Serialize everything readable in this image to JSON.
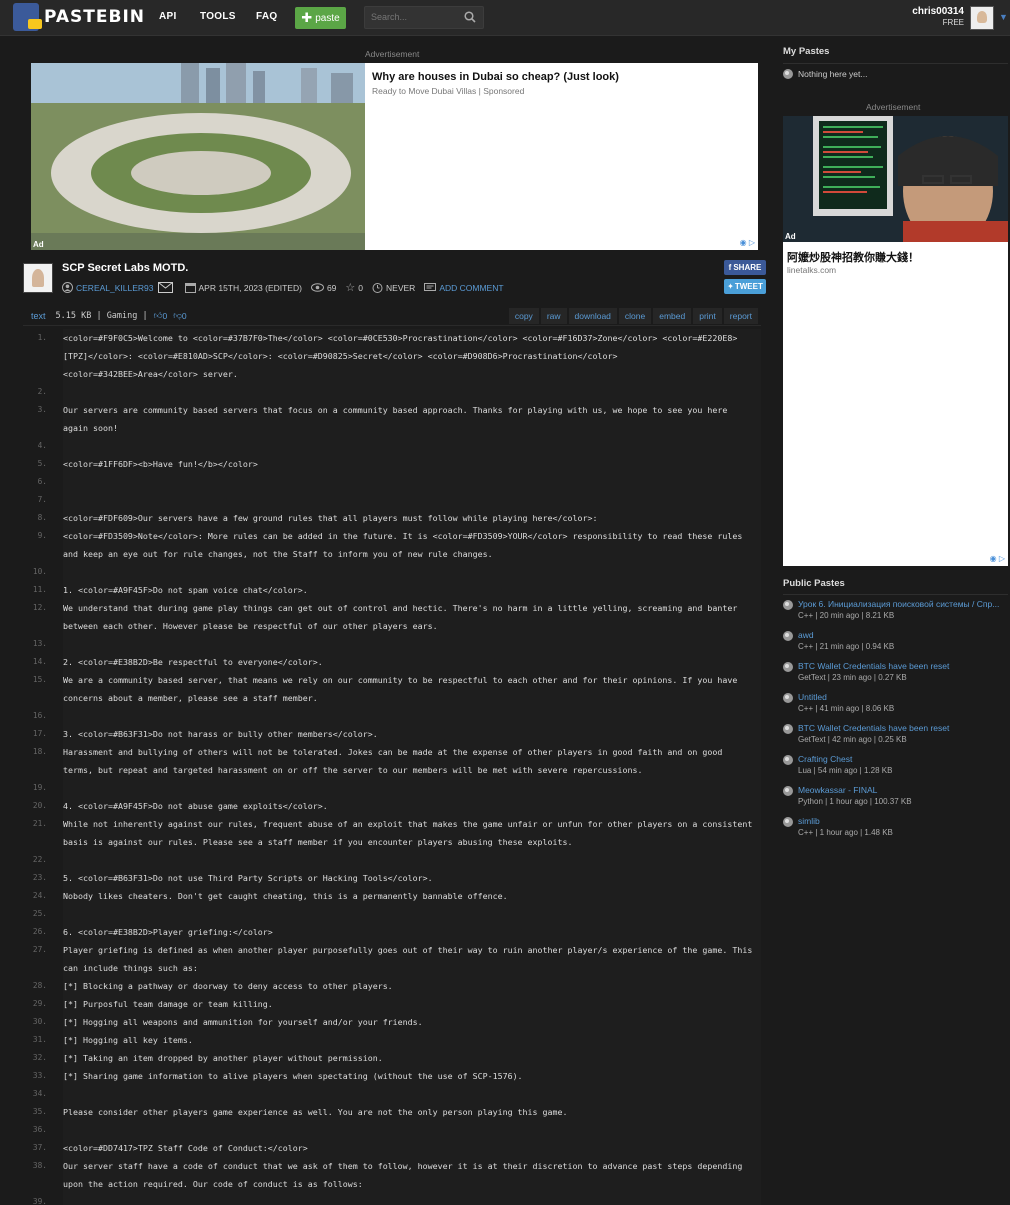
{
  "header": {
    "logo_text": "PASTEBIN",
    "nav": [
      "API",
      "TOOLS",
      "FAQ"
    ],
    "paste_button": "paste",
    "search_placeholder": "Search...",
    "username": "chris00314",
    "plan": "FREE"
  },
  "ad_top": {
    "label": "Advertisement",
    "title": "Why are houses in Dubai so cheap? (Just look)",
    "sponsor": "Ready to Move Dubai Villas | Sponsored",
    "ad_tag": "Ad"
  },
  "paste": {
    "title": "SCP Secret Labs MOTD.",
    "author": "CEREAL_KILLER93",
    "date": "APR 15TH, 2023 (EDITED)",
    "views": "69",
    "stars": "0",
    "expires": "NEVER",
    "add_comment": "ADD COMMENT",
    "share": "SHARE",
    "tweet": "TWEET"
  },
  "toolbar": {
    "format": "text",
    "info": "5.15 KB | Gaming |",
    "likes": "0",
    "dislikes": "0",
    "actions": [
      "copy",
      "raw",
      "download",
      "clone",
      "embed",
      "print",
      "report"
    ]
  },
  "code_lines": [
    {
      "n": "1.",
      "t": "<color=#F9F0C5>Welcome to <color=#37B7F0>The</color> <color=#0CE530>Procrastination</color> <color=#F16D37>Zone</color> <color=#E220E8>[TPZ]</color>: <color=#E810AD>SCP</color>: <color=#D90825>Secret</color> <color=#D908D6>Procrastination</color> <color=#342BEE>Area</color> server."
    },
    {
      "n": "2.",
      "t": ""
    },
    {
      "n": "3.",
      "t": "Our servers are community based servers that focus on a community based approach. Thanks for playing with us, we hope to see you here again soon!"
    },
    {
      "n": "4.",
      "t": ""
    },
    {
      "n": "5.",
      "t": "<color=#1FF6DF><b>Have fun!</b></color>"
    },
    {
      "n": "6.",
      "t": ""
    },
    {
      "n": "7.",
      "t": ""
    },
    {
      "n": "8.",
      "t": "<color=#FDF609>Our servers have a few ground rules that all players must follow while playing here</color>:"
    },
    {
      "n": "9.",
      "t": "<color=#FD3509>Note</color>: More rules can be added in the future. It is <color=#FD3509>YOUR</color> responsibility to read these rules and keep an eye out for rule changes, not the Staff to inform you of new rule changes."
    },
    {
      "n": "10.",
      "t": ""
    },
    {
      "n": "11.",
      "t": "1. <color=#A9F45F>Do not spam voice chat</color>."
    },
    {
      "n": "12.",
      "t": "We understand that during game play things can get out of control and hectic. There's no harm in a little yelling, screaming and banter between each other. However please be respectful of our other players ears."
    },
    {
      "n": "13.",
      "t": ""
    },
    {
      "n": "14.",
      "t": "2. <color=#E38B2D>Be respectful to everyone</color>."
    },
    {
      "n": "15.",
      "t": "We are a community based server, that means we rely on our community to be respectful to each other and for their opinions. If you have concerns about a member, please see a staff member."
    },
    {
      "n": "16.",
      "t": ""
    },
    {
      "n": "17.",
      "t": "3. <color=#B63F31>Do not harass or bully other members</color>."
    },
    {
      "n": "18.",
      "t": "Harassment and bullying of others will not be tolerated. Jokes can be made at the expense of other players in good faith and on good terms, but repeat and targeted harassment on or off the server to our members will be met with severe repercussions."
    },
    {
      "n": "19.",
      "t": ""
    },
    {
      "n": "20.",
      "t": "4. <color=#A9F45F>Do not abuse game exploits</color>."
    },
    {
      "n": "21.",
      "t": "While not inherently against our rules, frequent abuse of an exploit that makes the game unfair or unfun for other players on a consistent basis is against our rules. Please see a staff member if you encounter players abusing these exploits."
    },
    {
      "n": "22.",
      "t": ""
    },
    {
      "n": "23.",
      "t": "5. <color=#B63F31>Do not use Third Party Scripts or Hacking Tools</color>."
    },
    {
      "n": "24.",
      "t": "Nobody likes cheaters. Don't get caught cheating, this is a permanently bannable offence."
    },
    {
      "n": "25.",
      "t": ""
    },
    {
      "n": "26.",
      "t": "6. <color=#E38B2D>Player griefing:</color>"
    },
    {
      "n": "27.",
      "t": "Player griefing is defined as when another player purposefully goes out of their way to ruin another player/s experience of the game. This can include things such as:"
    },
    {
      "n": "28.",
      "t": "[*] Blocking a pathway or doorway to deny access to other players."
    },
    {
      "n": "29.",
      "t": "[*] Purposful team damage or team killing."
    },
    {
      "n": "30.",
      "t": "[*] Hogging all weapons and ammunition for yourself and/or your friends."
    },
    {
      "n": "31.",
      "t": "[*] Hogging all key items."
    },
    {
      "n": "32.",
      "t": "[*] Taking an item dropped by another player without permission."
    },
    {
      "n": "33.",
      "t": "[*] Sharing game information to alive players when spectating (without the use of SCP-1576)."
    },
    {
      "n": "34.",
      "t": ""
    },
    {
      "n": "35.",
      "t": "Please consider other players game experience as well. You are not the only person playing this game."
    },
    {
      "n": "36.",
      "t": ""
    },
    {
      "n": "37.",
      "t": "<color=#DD7417>TPZ Staff Code of Conduct:</color>"
    },
    {
      "n": "38.",
      "t": "Our server staff have a code of conduct that we ask of them to follow, however it is at their discretion to advance past steps depending upon the action required. Our code of conduct is as follows:"
    },
    {
      "n": "39.",
      "t": ""
    }
  ],
  "sidebar": {
    "my_pastes_heading": "My Pastes",
    "nothing_here": "Nothing here yet...",
    "ad_label": "Advertisement",
    "ad_title": "阿嬤炒股神招教你賺大錢！",
    "ad_url": "linetalks.com",
    "ad_tag": "Ad",
    "public_heading": "Public Pastes",
    "public_pastes": [
      {
        "title": "Урок 6. Инициализация поисковой системы / Спр...",
        "meta": "C++ | 20 min ago | 8.21 KB"
      },
      {
        "title": "awd",
        "meta": "C++ | 21 min ago | 0.94 KB"
      },
      {
        "title": "BTC Wallet Credentials have been reset",
        "meta": "GetText | 23 min ago | 0.27 KB"
      },
      {
        "title": "Untitled",
        "meta": "C++ | 41 min ago | 8.06 KB"
      },
      {
        "title": "BTC Wallet Credentials have been reset",
        "meta": "GetText | 42 min ago | 0.25 KB"
      },
      {
        "title": "Crafting Chest",
        "meta": "Lua | 54 min ago | 1.28 KB"
      },
      {
        "title": "Meowkassar - FINAL",
        "meta": "Python | 1 hour ago | 100.37 KB"
      },
      {
        "title": "simlib",
        "meta": "C++ | 1 hour ago | 1.48 KB"
      }
    ]
  }
}
